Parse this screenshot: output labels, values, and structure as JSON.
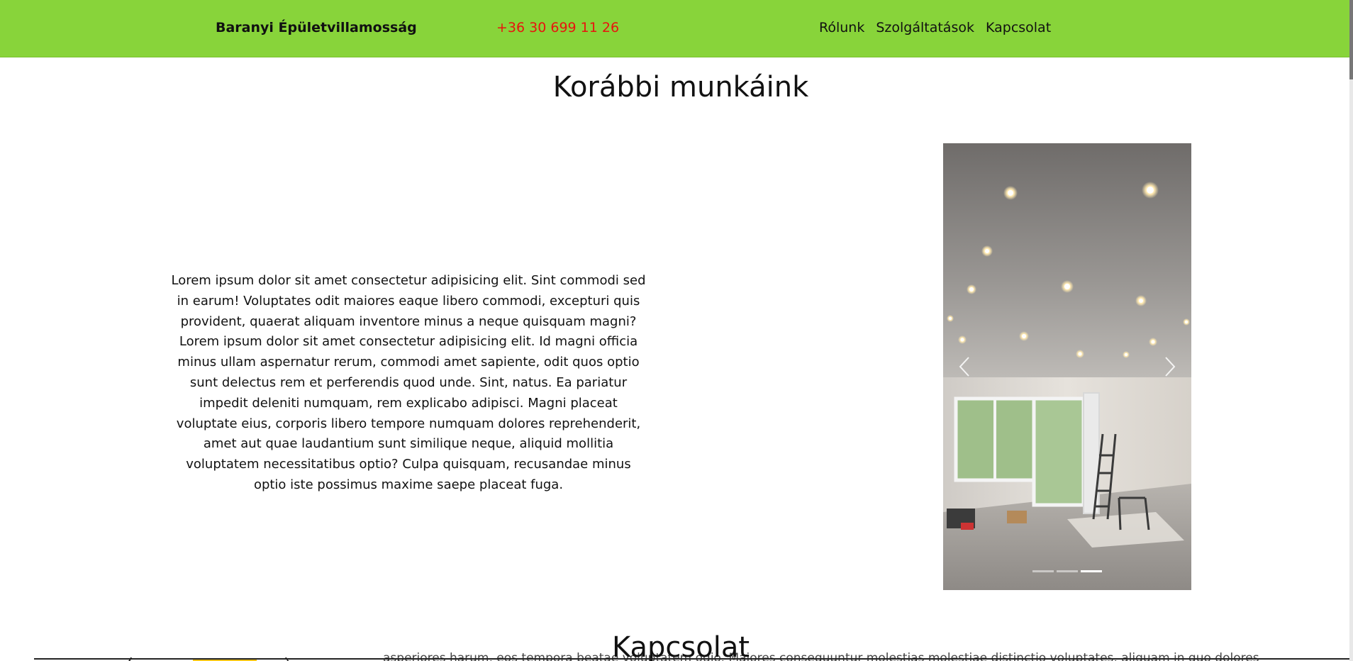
{
  "navbar": {
    "brand": "Baranyi Épületvillamosság",
    "phone": "+36 30 699 11 26",
    "links": [
      "Rólunk",
      "Szolgáltatások",
      "Kapcsolat"
    ],
    "bg_color": "#88d43a",
    "phone_color": "#e8140e"
  },
  "works": {
    "title": "Korábbi munkáink",
    "description": "Lorem ipsum dolor sit amet consectetur adipisicing elit. Sint commodi sed in earum! Voluptates odit maiores eaque libero commodi, excepturi quis provident, quaerat aliquam inventore minus a neque quisquam magni? Lorem ipsum dolor sit amet consectetur adipisicing elit. Id magni officia minus ullam aspernatur rerum, commodi amet sapiente, odit quos optio sunt delectus rem et perferendis quod unde. Sint, natus. Ea pariatur impedit deleniti numquam, rem explicabo adipisci. Magni placeat voluptate eius, corporis libero tempore numquam dolores reprehenderit, amet aut quae laudantium sunt similique neque, aliquid mollitia voluptatem necessitatibus optio? Culpa quisquam, recusandae minus optio iste possimus maxime saepe placeat fuga.",
    "carousel": {
      "prev_icon": "chevron-left-icon",
      "next_icon": "chevron-right-icon",
      "slide_count": 3,
      "active_index": 2
    }
  },
  "contact": {
    "title": "Kapcsolat",
    "peek_text": "asperiores harum, eos tempora beatae voluptatem odio. Maiores consequuntur molestias molestiae distinctio voluptates, aliquam in quo dolores"
  }
}
